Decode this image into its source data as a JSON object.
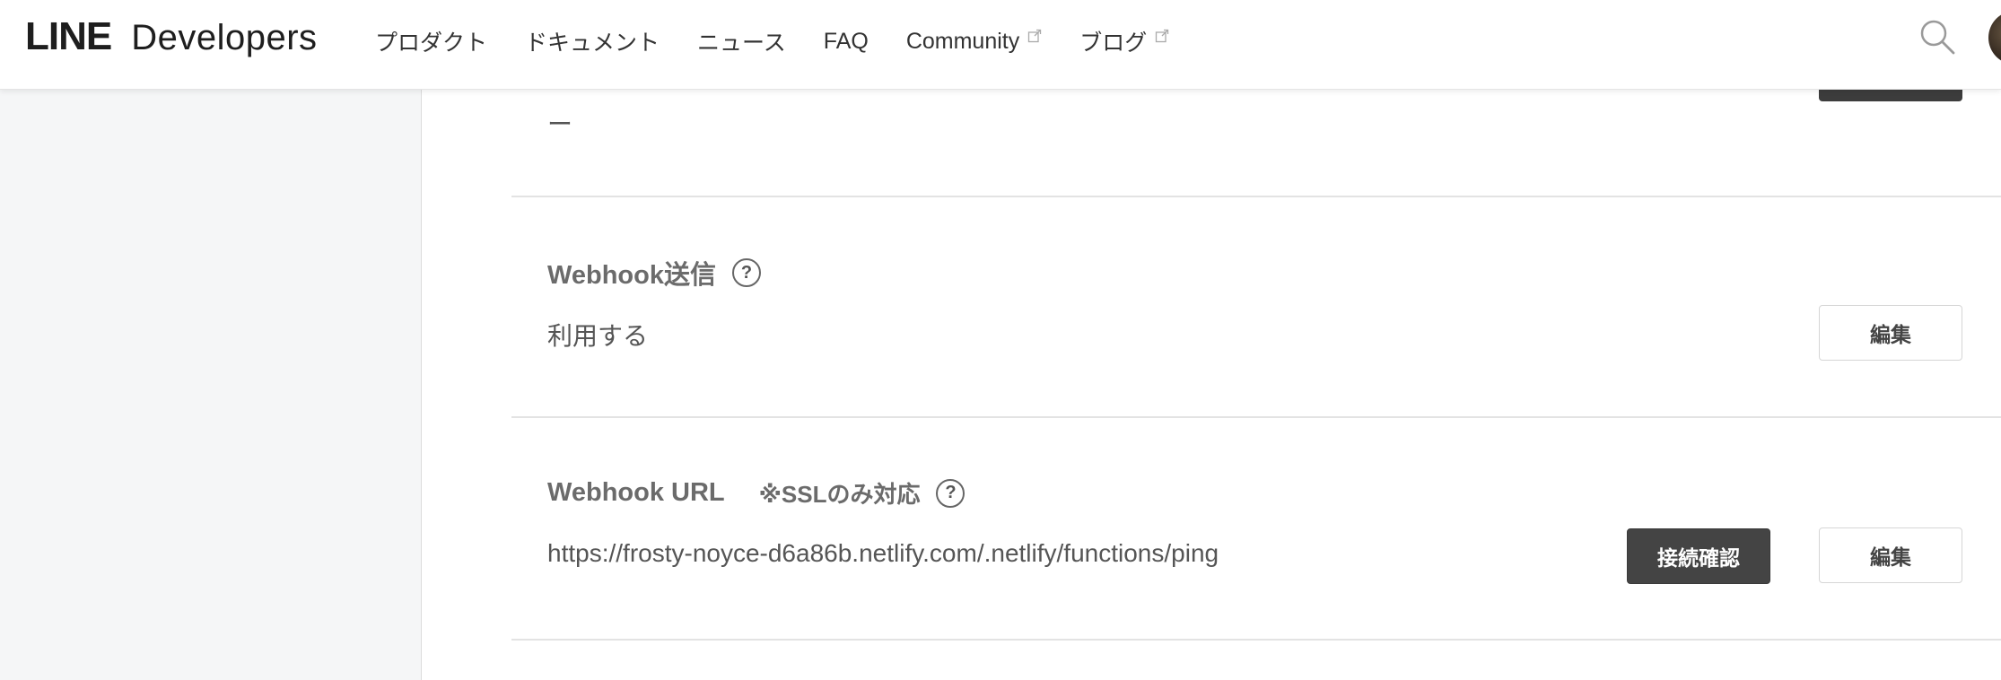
{
  "header": {
    "logo_line": "LINE",
    "logo_developers": "Developers",
    "nav": [
      {
        "label": "プロダクト",
        "external": false
      },
      {
        "label": "ドキュメント",
        "external": false
      },
      {
        "label": "ニュース",
        "external": false
      },
      {
        "label": "FAQ",
        "external": false
      },
      {
        "label": "Community",
        "external": true
      },
      {
        "label": "ブログ",
        "external": true
      }
    ],
    "search_icon": "search-icon"
  },
  "main": {
    "prev_value": "ー",
    "webhook_send": {
      "title": "Webhook送信",
      "value": "利用する",
      "edit_label": "編集"
    },
    "webhook_url": {
      "title": "Webhook URL",
      "note": "※SSLのみ対応",
      "value": "https://frosty-noyce-d6a86b.netlify.com/.netlify/functions/ping",
      "verify_label": "接続確認",
      "edit_label": "編集"
    }
  },
  "colors": {
    "dark_button": "#444444",
    "sidebar_bg": "#f5f6f7",
    "divider": "#e3e3e3"
  }
}
